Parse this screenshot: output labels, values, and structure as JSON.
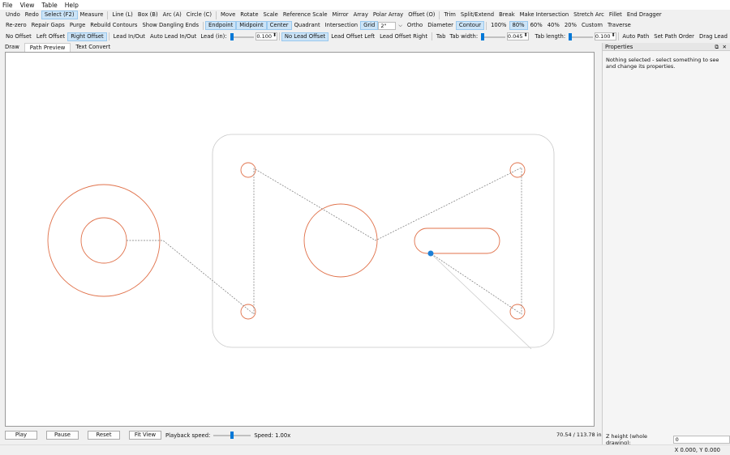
{
  "menubar": [
    "File",
    "View",
    "Table",
    "Help"
  ],
  "toolbar1": [
    "Undo",
    "Redo",
    "Select (F2)",
    "Measure",
    "|",
    "Line (L)",
    "Box (B)",
    "Arc (A)",
    "Circle (C)",
    "|",
    "Move",
    "Rotate",
    "Scale",
    "Reference Scale",
    "Mirror",
    "Array",
    "Polar Array",
    "Offset (O)",
    "|",
    "Trim",
    "Split/Extend",
    "Break",
    "Make Intersection",
    "Stretch Arc",
    "Fillet",
    "End Dragger"
  ],
  "toolbar1_active": [
    "Select (F2)"
  ],
  "toolbar2": {
    "left": [
      "Re-zero",
      "Repair Gaps",
      "Purge",
      "Rebuild Contours",
      "Show Dangling Ends"
    ],
    "snaps": [
      "Endpoint",
      "Midpoint",
      "Center",
      "Quadrant",
      "Intersection",
      "Grid"
    ],
    "snaps_active": [
      "Endpoint",
      "Midpoint",
      "Center",
      "Grid"
    ],
    "grid_value": "2\"",
    "modes": [
      "Ortho",
      "Diameter",
      "Contour"
    ],
    "modes_active": [
      "Contour"
    ],
    "zoom": [
      "100%",
      "80%",
      "60%",
      "40%",
      "20%",
      "Custom",
      "Traverse"
    ],
    "zoom_active": "80%"
  },
  "toolbar3": {
    "offsets": [
      "No Offset",
      "Left Offset",
      "Right Offset"
    ],
    "offset_active": "Right Offset",
    "lead_buttons": [
      "Lead In/Out",
      "Auto Lead In/Out"
    ],
    "lead_label": "Lead (in):",
    "lead_value": "0.100",
    "lead_modes": [
      "No Lead Offset",
      "Lead Offset Left",
      "Lead Offset Right"
    ],
    "lead_mode_active": "No Lead Offset",
    "tab_button": "Tab",
    "tab_width_label": "Tab width:",
    "tab_width_value": "0.045",
    "tab_length_label": "Tab length:",
    "tab_length_value": "0.100",
    "path_buttons": [
      "Auto Path",
      "Set Path Order",
      "Drag Lead"
    ]
  },
  "tabs": [
    "Draw",
    "Path Preview",
    "Text Convert"
  ],
  "active_tab": "Path Preview",
  "canvas_colors": {
    "cut": "#e0714a",
    "travel": "#777777",
    "outline": "#c8c8c8",
    "marker": "#1c7fd6"
  },
  "playback": {
    "play": "Play",
    "pause": "Pause",
    "reset": "Reset",
    "fit": "Fit View",
    "speed_label": "Playback speed:",
    "speed_value": "Speed: 1.00x",
    "slider_fraction": 0.5
  },
  "progress_text": "70.54 / 113.78 in",
  "properties": {
    "title": "Properties",
    "message": "Nothing selected - select something to see and change its properties.",
    "z_label": "Z height (whole drawing):",
    "z_value": "0"
  },
  "status": "X 0.000, Y 0.000"
}
